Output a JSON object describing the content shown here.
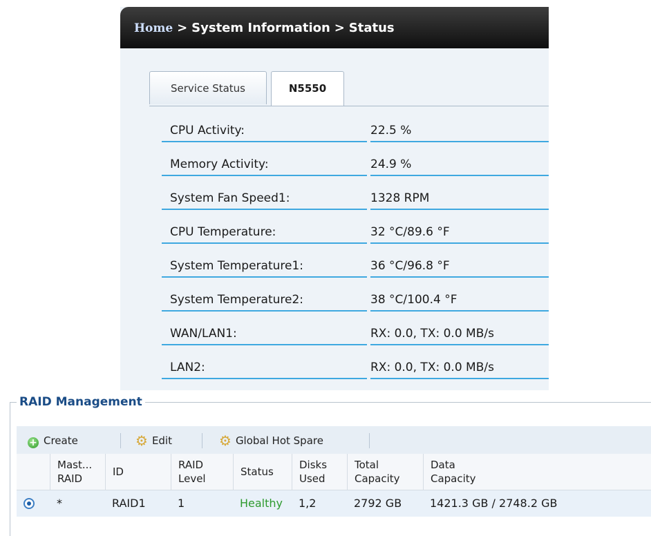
{
  "breadcrumb": {
    "home": "Home",
    "sep1": ">",
    "item1": "System Information",
    "sep2": ">",
    "item2": "Status"
  },
  "tabs": [
    {
      "label": "Service Status"
    },
    {
      "label": "N5550"
    }
  ],
  "status_rows": [
    {
      "label": "CPU Activity:",
      "value": "22.5 %"
    },
    {
      "label": "Memory Activity:",
      "value": "24.9 %"
    },
    {
      "label": "System Fan Speed1:",
      "value": "1328 RPM"
    },
    {
      "label": "CPU Temperature:",
      "value": "32 °C/89.6 °F"
    },
    {
      "label": "System Temperature1:",
      "value": "36 °C/96.8 °F"
    },
    {
      "label": "System Temperature2:",
      "value": "38 °C/100.4 °F"
    },
    {
      "label": "WAN/LAN1:",
      "value": "RX: 0.0, TX: 0.0 MB/s"
    },
    {
      "label": "LAN2:",
      "value": "RX: 0.0, TX: 0.0 MB/s"
    }
  ],
  "raid": {
    "title": "RAID Management",
    "toolbar": {
      "create": "Create",
      "edit": "Edit",
      "global_hot_spare": "Global Hot Spare"
    },
    "columns": {
      "master_1": "Mast...",
      "master_2": "RAID",
      "id": "ID",
      "level_1": "RAID",
      "level_2": "Level",
      "status": "Status",
      "disks_1": "Disks",
      "disks_2": "Used",
      "total_1": "Total",
      "total_2": "Capacity",
      "data_1": "Data",
      "data_2": "Capacity"
    },
    "rows": [
      {
        "master": "*",
        "id": "RAID1",
        "level": "1",
        "status": "Healthy",
        "disks": "1,2",
        "total": "2792 GB",
        "data": "1421.3 GB / 2748.2 GB"
      }
    ],
    "colors": {
      "healthy": "#2e9a2e",
      "legend": "#1a4c86",
      "row_rule": "#3ea8e0"
    },
    "icons": {
      "create": "plus-circle-icon",
      "edit": "gear-pencil-icon",
      "hot_spare": "gear-icon"
    }
  }
}
